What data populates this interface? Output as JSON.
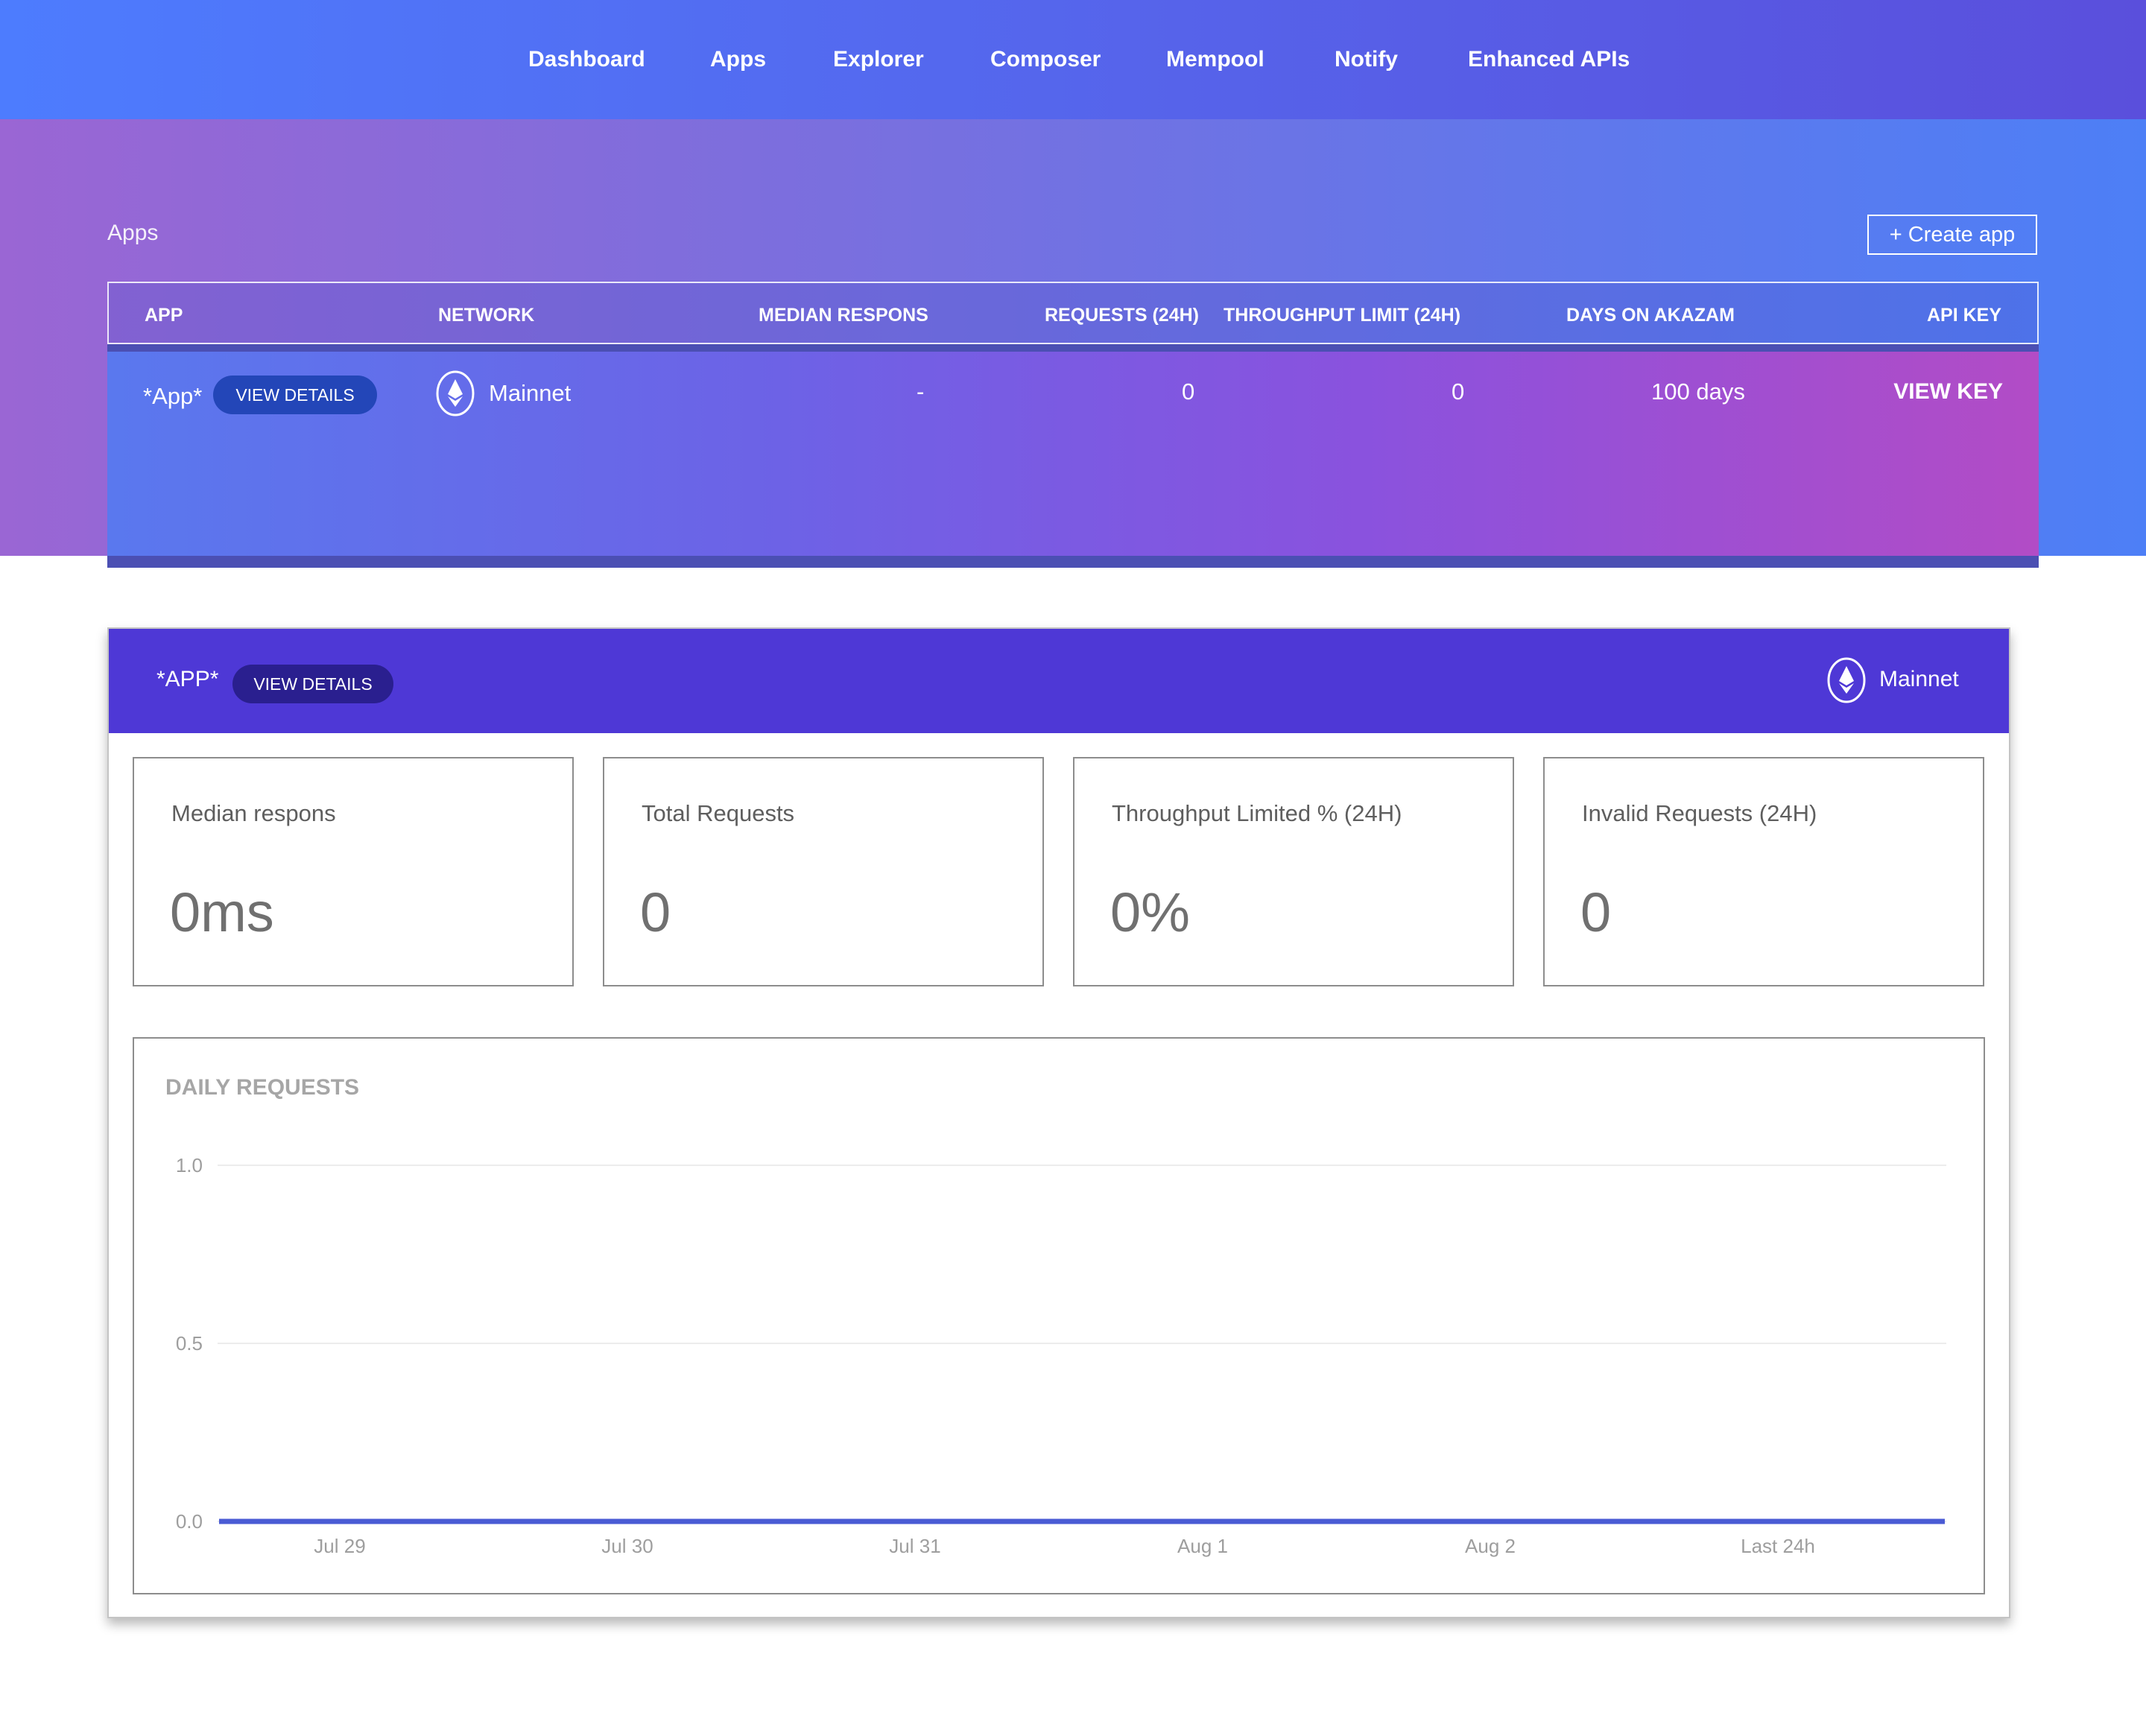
{
  "nav": {
    "items": [
      "Dashboard",
      "Apps",
      "Explorer",
      "Composer",
      "Mempool",
      "Notify",
      "Enhanced APIs"
    ]
  },
  "apps_section": {
    "title": "Apps",
    "create_button": "+ Create app",
    "columns": [
      "APP",
      "NETWORK",
      "MEDIAN RESPONS",
      "REQUESTS (24H)",
      "THROUGHPUT LIMIT (24H)",
      "DAYS ON AKAZAM",
      "API KEY"
    ],
    "row": {
      "app_name": "*App*",
      "view_details": "VIEW DETAILS",
      "network": "Mainnet",
      "median_response": "-",
      "requests": "0",
      "throughput_limit": "0",
      "days": "100 days",
      "api_key_action": "VIEW KEY"
    }
  },
  "app_card": {
    "name": "*APP*",
    "view_details": "VIEW DETAILS",
    "network": "Mainnet",
    "stats": [
      {
        "label": "Median respons",
        "value": "0ms"
      },
      {
        "label": "Total Requests",
        "value": "0"
      },
      {
        "label": "Throughput Limited % (24H)",
        "value": "0%"
      },
      {
        "label": "Invalid Requests (24H)",
        "value": "0"
      }
    ]
  },
  "chart_data": {
    "type": "line",
    "title": "DAILY REQUESTS",
    "categories": [
      "Jul 29",
      "Jul 30",
      "Jul 31",
      "Aug 1",
      "Aug 2",
      "Last 24h"
    ],
    "series": [
      {
        "values": [
          0,
          0,
          0,
          0,
          0,
          0
        ]
      }
    ],
    "yticks": [
      "1.0",
      "0.5",
      "0.0"
    ],
    "ylim": [
      0,
      1
    ],
    "grid": true,
    "series_color": "#4a5bd4"
  },
  "colors": {
    "accent": "#4e38d6",
    "pill_dark": "#2a1f8f",
    "pill_blue": "#2346b8"
  }
}
